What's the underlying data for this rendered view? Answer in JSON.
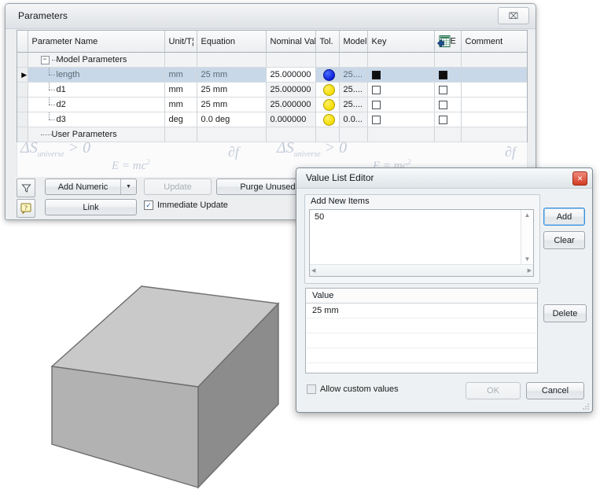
{
  "parameters_window": {
    "title": "Parameters",
    "close_label": "⌧",
    "close_icon": "close-icon",
    "grid": {
      "columns": [
        {
          "key": "name",
          "label": "Parameter Name"
        },
        {
          "key": "unit",
          "label": "Unit/T¦"
        },
        {
          "key": "equation",
          "label": "Equation"
        },
        {
          "key": "nominal",
          "label": "Nominal Val¦"
        },
        {
          "key": "tol",
          "label": "Tol."
        },
        {
          "key": "model",
          "label": "Model"
        },
        {
          "key": "key",
          "label": "Key"
        },
        {
          "key": "export",
          "label": "E"
        },
        {
          "key": "comment",
          "label": "Comment"
        }
      ],
      "export_icon": "export-to-spreadsheet-icon",
      "rows": [
        {
          "type": "group",
          "name": "Model Parameters",
          "expander": "−",
          "expanded": true,
          "unit": "",
          "equation": "",
          "nominal": "",
          "tol": "",
          "model": "",
          "key": "",
          "export": "",
          "comment": ""
        },
        {
          "type": "param",
          "selected": true,
          "name": "length",
          "unit": "mm",
          "equation": "25 mm",
          "nominal": "25.000000",
          "tol_color": "#0b1fd8",
          "tol_state": "blue",
          "model": "25....",
          "key_checked": true,
          "export_checked": true,
          "comment": ""
        },
        {
          "type": "param",
          "selected": false,
          "name": "d1",
          "unit": "mm",
          "equation": "25 mm",
          "nominal": "25.000000",
          "tol_color": "#f5dc00",
          "tol_state": "yellow",
          "model": "25....",
          "key_checked": false,
          "export_checked": false,
          "comment": ""
        },
        {
          "type": "param",
          "selected": false,
          "name": "d2",
          "unit": "mm",
          "equation": "25 mm",
          "nominal": "25.000000",
          "tol_color": "#f5dc00",
          "tol_state": "yellow",
          "model": "25....",
          "key_checked": false,
          "export_checked": false,
          "comment": ""
        },
        {
          "type": "param",
          "selected": false,
          "name": "d3",
          "unit": "deg",
          "equation": "0.0 deg",
          "nominal": "0.000000",
          "tol_color": "#f5dc00",
          "tol_state": "yellow",
          "model": "0.0...",
          "key_checked": false,
          "export_checked": false,
          "comment": ""
        },
        {
          "type": "group",
          "name": "User Parameters",
          "expander": "",
          "expanded": true,
          "unit": "",
          "equation": "",
          "nominal": "",
          "tol": "",
          "model": "",
          "key": "",
          "export": "",
          "comment": ""
        }
      ]
    },
    "watermark": {
      "entropy": "ΔS",
      "entropy_sub": "universe",
      "entropy_rel": "> 0",
      "partial": "∂f",
      "emc2": "E = mc",
      "emc2_sup": "2"
    },
    "toolbar": {
      "filter_icon": "filter-funnel-icon",
      "help_icon": "help-question-icon",
      "add_numeric_label": "Add Numeric",
      "add_numeric_arrow": "▼",
      "update_label": "Update",
      "update_enabled": false,
      "purge_unused_label": "Purge Unused",
      "link_label": "Link",
      "immediate_update_label": "Immediate Update",
      "immediate_update_checked": true,
      "check_glyph": "✓"
    }
  },
  "value_list_editor": {
    "title": "Value List Editor",
    "close_label": "✕",
    "close_icon": "close-icon",
    "add_new_items": {
      "group_label": "Add New Items",
      "items": [
        "50"
      ],
      "scroll_up": "▲",
      "scroll_down": "▼",
      "scroll_left": "◀",
      "scroll_right": "▶"
    },
    "add_button": "Add",
    "clear_button": "Clear",
    "value_list": {
      "header": "Value",
      "rows": [
        "25 mm",
        "",
        "",
        "",
        "",
        ""
      ]
    },
    "delete_button": "Delete",
    "allow_custom_values_label": "Allow custom values",
    "allow_custom_values_checked": false,
    "ok_button": "OK",
    "ok_enabled": false,
    "cancel_button": "Cancel"
  },
  "viewport": {
    "model_name": "cube-3d-model",
    "face_top_color": "#c9c9c9",
    "face_left_color": "#b2b2b2",
    "face_right_color": "#8c8c8c",
    "edge_color": "#6d6d6d"
  },
  "theme": {
    "window_bg": "#eceef0",
    "selection_blue": "#c9d8e8",
    "accent_red": "#d23b22",
    "focus_blue": "#3d8fd8"
  }
}
